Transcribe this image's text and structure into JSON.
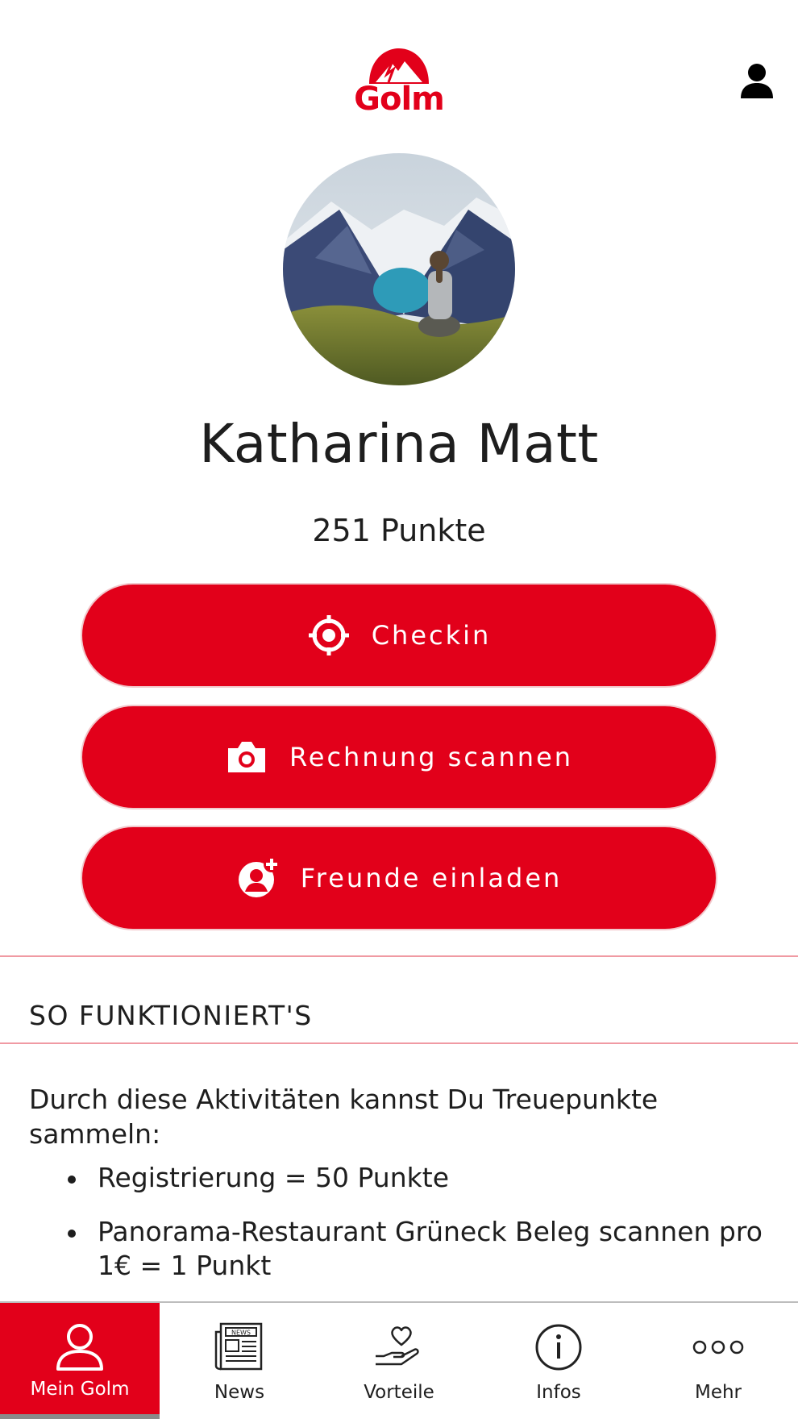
{
  "header": {
    "logo_text": "Golm",
    "profile_icon": "person-icon"
  },
  "profile": {
    "name": "Katharina Matt",
    "points": "251 Punkte"
  },
  "actions": [
    {
      "label": "Checkin",
      "icon": "target-icon"
    },
    {
      "label": "Rechnung scannen",
      "icon": "camera-icon"
    },
    {
      "label": "Freunde einladen",
      "icon": "add-friend-icon"
    }
  ],
  "info": {
    "heading": "SO FUNKTIONIERT'S",
    "intro": "Durch diese Aktivitäten kannst Du Treuepunkte sammeln:",
    "items": [
      "Registrierung = 50 Punkte",
      "Panorama-Restaurant Grüneck Beleg scannen pro 1€ = 1 Punkt"
    ]
  },
  "nav": {
    "items": [
      {
        "label": "Mein Golm",
        "icon": "user-outline-icon",
        "active": true
      },
      {
        "label": "News",
        "icon": "newspaper-icon",
        "active": false
      },
      {
        "label": "Vorteile",
        "icon": "heart-hand-icon",
        "active": false
      },
      {
        "label": "Infos",
        "icon": "info-icon",
        "active": false
      },
      {
        "label": "Mehr",
        "icon": "more-dots-icon",
        "active": false
      }
    ]
  },
  "colors": {
    "brand_red": "#e2001a",
    "divider": "#f09aa3",
    "text": "#1e1e1e"
  }
}
